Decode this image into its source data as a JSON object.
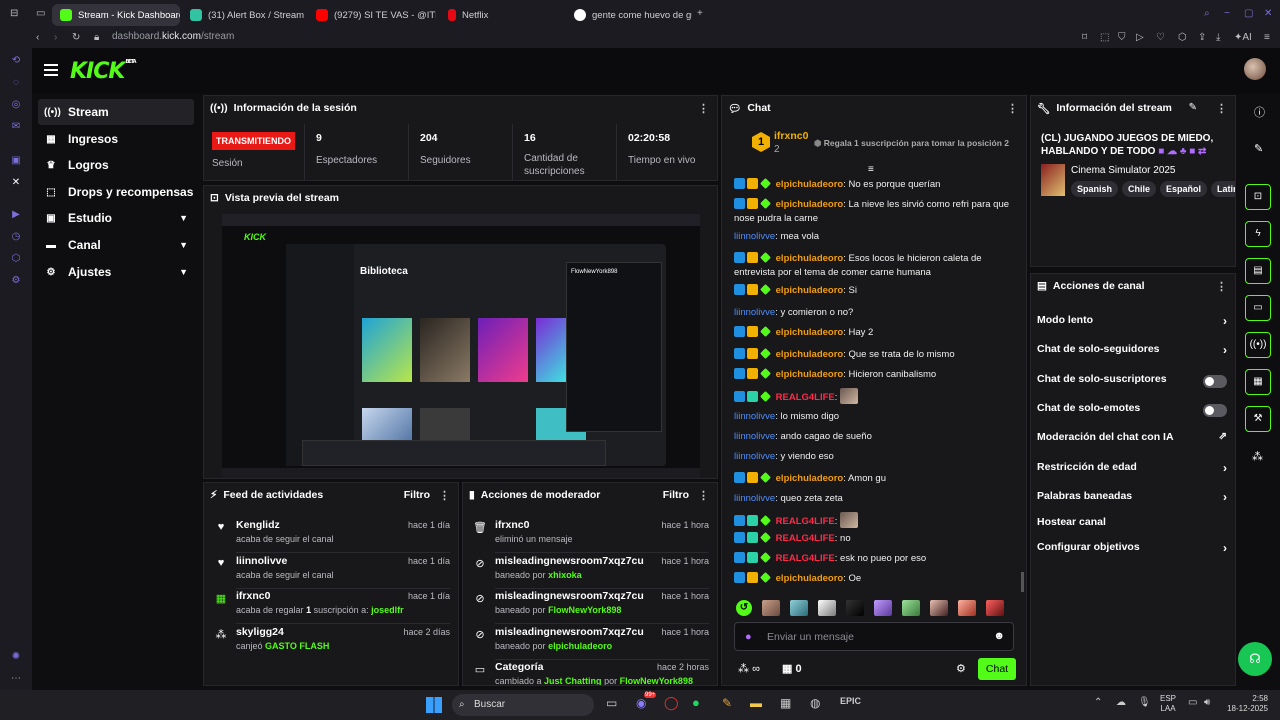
{
  "browser": {
    "tabs": [
      {
        "title": "Stream - Kick Dashboard",
        "active": true
      },
      {
        "title": "(31) Alert Box / Streamlab"
      },
      {
        "title": "(9279) SI TE VAS - @ITH"
      },
      {
        "title": "Netflix"
      },
      {
        "title": "gente come huevo de gu"
      }
    ],
    "url_prefix": "dashboard.",
    "url_host": "kick.com",
    "url_path": "/stream",
    "ai_label": "AI"
  },
  "logo": {
    "text": "KICK",
    "beta": "BETA"
  },
  "sidebar": {
    "items": [
      {
        "label": "Stream",
        "icon": "broadcast-icon"
      },
      {
        "label": "Ingresos",
        "icon": "revenue-icon"
      },
      {
        "label": "Logros",
        "icon": "trophy-icon"
      },
      {
        "label": "Drops y recompensas",
        "icon": "gift-icon"
      },
      {
        "label": "Estudio",
        "icon": "studio-icon"
      },
      {
        "label": "Canal",
        "icon": "channel-icon"
      },
      {
        "label": "Ajustes",
        "icon": "settings-icon"
      }
    ]
  },
  "session": {
    "title": "Información de la sesión",
    "live_badge": "TRANSMITIENDO",
    "live_label": "Sesión",
    "stats": [
      {
        "value": "9",
        "label": "Espectadores"
      },
      {
        "value": "204",
        "label": "Seguidores"
      },
      {
        "value": "16",
        "label": "Cantidad de suscripciones"
      },
      {
        "value": "02:20:58",
        "label": "Tiempo en vivo"
      }
    ]
  },
  "preview": {
    "title": "Vista previa del stream",
    "inner_title": "Biblioteca",
    "inner_user": "FlowNewYork898"
  },
  "feed": {
    "title": "Feed de actividades",
    "filter": "Filtro",
    "items": [
      {
        "name": "Kenglidz",
        "desc": "acaba de seguir el canal",
        "time": "hace 1 día"
      },
      {
        "name": "liinnolivve",
        "desc": "acaba de seguir el canal",
        "time": "hace 1 día"
      },
      {
        "name": "ifrxnc0",
        "desc": "acaba de regalar",
        "count": "1",
        "desc2": "suscripción a:",
        "target": "josedlfr",
        "time": "hace 1 día"
      },
      {
        "name": "skyligg24",
        "desc": "canjeó",
        "target": "GASTO FLASH",
        "time": "hace 2 días"
      }
    ]
  },
  "mod": {
    "title": "Acciones de moderador",
    "filter": "Filtro",
    "items": [
      {
        "name": "ifrxnc0",
        "desc": "eliminó un mensaje",
        "time": "hace 1 hora"
      },
      {
        "name": "misleadingnewsroom7xqz7cu",
        "desc": "baneado por",
        "by": "xhixoka",
        "time": "hace 1 hora"
      },
      {
        "name": "misleadingnewsroom7xqz7cu",
        "desc": "baneado por",
        "by": "FlowNewYork898",
        "time": "hace 1 hora"
      },
      {
        "name": "misleadingnewsroom7xqz7cu",
        "desc": "baneado por",
        "by": "elpichuladeoro",
        "time": "hace 1 hora"
      },
      {
        "name": "Categoría",
        "desc": "cambiado a",
        "by": "Just Chatting",
        "desc2": "por",
        "by2": "FlowNewYork898",
        "time": "hace 2 horas"
      }
    ]
  },
  "chat": {
    "title": "Chat",
    "top_rank": "1",
    "top_user": "ifrxnc0",
    "top_count": "2",
    "gift_prompt": "Regala 1 suscripción para tomar la posición 2",
    "messages": [
      {
        "user": "elpichuladeoro",
        "text": ": No es porque querían"
      },
      {
        "user": "elpichuladeoro",
        "text": ": La nieve les sirvió como refri para que nose pudra la carne"
      },
      {
        "user": "liinnolivve",
        "text": ": mea vola"
      },
      {
        "user": "elpichuladeoro",
        "text": ": Esos locos le hicieron caleta de entrevista por el tema de comer carne humana"
      },
      {
        "user": "elpichuladeoro",
        "text": ": Si"
      },
      {
        "user": "liinnolivve",
        "text": ": y comieron o no?"
      },
      {
        "user": "elpichuladeoro",
        "text": ": Hay 2"
      },
      {
        "user": "elpichuladeoro",
        "text": ": Que se trata de lo mismo"
      },
      {
        "user": "elpichuladeoro",
        "text": ": Hicieron canibalismo"
      },
      {
        "user": "REALG4LIFE",
        "text": ":"
      },
      {
        "user": "liinnolivve",
        "text": ": lo mismo digo"
      },
      {
        "user": "liinnolivve",
        "text": ": ando cagao de sueño"
      },
      {
        "user": "liinnolivve",
        "text": ": y viendo eso"
      },
      {
        "user": "elpichuladeoro",
        "text": ": Amon gu"
      },
      {
        "user": "liinnolivve",
        "text": ": queo zeta zeta"
      },
      {
        "user": "REALG4LIFE",
        "text": ":"
      },
      {
        "user": "REALG4LIFE",
        "text": ": no"
      },
      {
        "user": "REALG4LIFE",
        "text": ": esk no pueo por eso"
      },
      {
        "user": "elpichuladeoro",
        "text": ": Oe"
      }
    ],
    "input_placeholder": "Enviar un mensaje",
    "infinity": "∞",
    "count": "0",
    "send": "Chat"
  },
  "info": {
    "title": "Información del stream",
    "stream_title": "(CL) JUGANDO JUEGOS DE MIEDO, HABLANDO Y DE TODO",
    "game": "Cinema Simulator 2025",
    "tags": [
      "Spanish",
      "Chile",
      "Español",
      "Latino"
    ]
  },
  "actions": {
    "title": "Acciones de canal",
    "items": [
      {
        "label": "Modo lento",
        "kind": "chevron"
      },
      {
        "label": "Chat de solo-seguidores",
        "kind": "chevron"
      },
      {
        "label": "Chat de solo-suscriptores",
        "kind": "toggle"
      },
      {
        "label": "Chat de solo-emotes",
        "kind": "toggle"
      },
      {
        "label": "Moderación del chat con IA",
        "kind": "external"
      },
      {
        "label": "Restricción de edad",
        "kind": "chevron"
      },
      {
        "label": "Palabras baneadas",
        "kind": "chevron"
      },
      {
        "label": "Hostear canal",
        "kind": "none"
      },
      {
        "label": "Configurar objetivos",
        "kind": "chevron"
      }
    ]
  },
  "taskbar": {
    "search": "Buscar",
    "lang": "ESP",
    "lang2": "LAA",
    "time": "2:58",
    "date": "18-12-2025",
    "badge": "99+"
  },
  "colors": {
    "accent": "#53fc18",
    "live": "#e91916",
    "panel": "#18181b"
  }
}
